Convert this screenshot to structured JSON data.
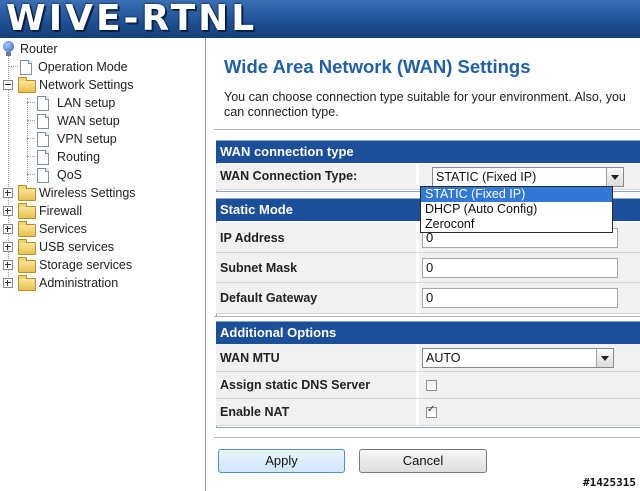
{
  "banner": {
    "logo_text": "WIVE-RTNL"
  },
  "sidebar": {
    "root": "Router",
    "items": [
      {
        "label": "Operation Mode"
      },
      {
        "label": "Network Settings"
      },
      {
        "label": "LAN setup"
      },
      {
        "label": "WAN setup"
      },
      {
        "label": "VPN setup"
      },
      {
        "label": "Routing"
      },
      {
        "label": "QoS"
      },
      {
        "label": "Wireless Settings"
      },
      {
        "label": "Firewall"
      },
      {
        "label": "Services"
      },
      {
        "label": "USB services"
      },
      {
        "label": "Storage services"
      },
      {
        "label": "Administration"
      }
    ]
  },
  "main": {
    "title": "Wide Area Network (WAN) Settings",
    "description": "You can choose connection type suitable for your environment. Also, you can connection type.",
    "wan_section": {
      "header": "WAN connection type",
      "type_label": "WAN Connection Type:",
      "type_value": "STATIC (Fixed IP)",
      "options": [
        "STATIC (Fixed IP)",
        "DHCP (Auto Config)",
        "Zeroconf"
      ]
    },
    "static_section": {
      "header": "Static Mode",
      "ip_label": "IP Address",
      "ip_value": "0",
      "mask_label": "Subnet Mask",
      "mask_value": "0",
      "gw_label": "Default Gateway",
      "gw_value": "0"
    },
    "additional_section": {
      "header": "Additional Options",
      "mtu_label": "WAN MTU",
      "mtu_value": "AUTO",
      "dns_label": "Assign static DNS Server",
      "dns_checked": false,
      "nat_label": "Enable NAT",
      "nat_checked": true
    },
    "buttons": {
      "apply": "Apply",
      "cancel": "Cancel"
    }
  },
  "watermark": "#1425315"
}
